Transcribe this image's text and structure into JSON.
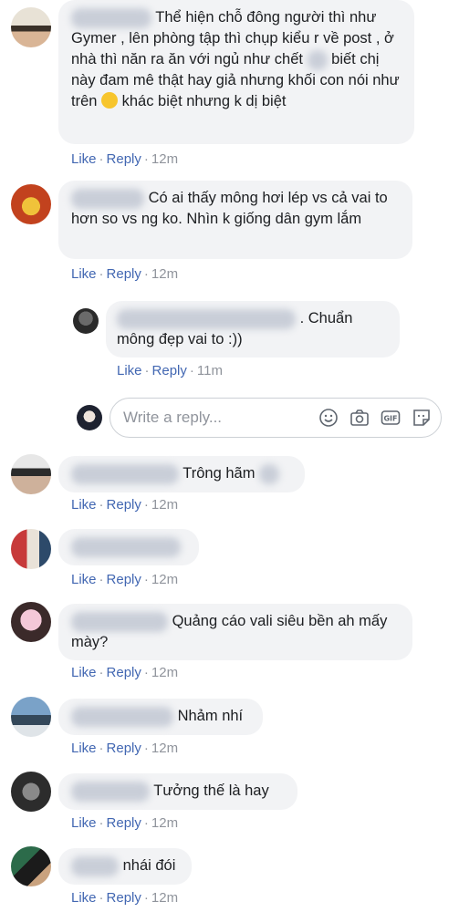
{
  "actions": {
    "like": "Like",
    "reply": "Reply",
    "dot": "·"
  },
  "comments": [
    {
      "text": "Thể hiện chỗ đông người thì như Gymer , lên phòng tập thì chụp kiểu r về post , ở nhà thì năn ra ăn với ngủ như chết",
      "text2": "biết chị này đam mê thật hay giả nhưng khối con nói như trên",
      "text3": "khác biệt nhưng k dị biệt",
      "time": "12m"
    },
    {
      "text": "Có ai thấy mông hơi lép vs cả vai to hơn so vs ng ko. Nhìn k giống dân gym lắm",
      "time": "12m"
    },
    {
      "text": ". Chuẩn mông đẹp vai to :))",
      "time": "11m"
    },
    {
      "text": "Trông hãm",
      "time": "12m"
    },
    {
      "text": "",
      "time": "12m"
    },
    {
      "text": "Quảng cáo vali siêu bền ah mấy mày?",
      "time": "12m"
    },
    {
      "text": "Nhảm nhí",
      "time": "12m"
    },
    {
      "text": "Tưởng thế là hay",
      "time": "12m"
    },
    {
      "text": "nhái đói",
      "time": "12m"
    }
  ],
  "reply_box": {
    "placeholder": "Write a reply...",
    "icons": [
      "emoji-icon",
      "camera-icon",
      "gif-icon",
      "sticker-icon"
    ]
  },
  "colors": {
    "link": "#4267b2",
    "meta": "#90949c",
    "bubble": "#f2f3f5"
  }
}
